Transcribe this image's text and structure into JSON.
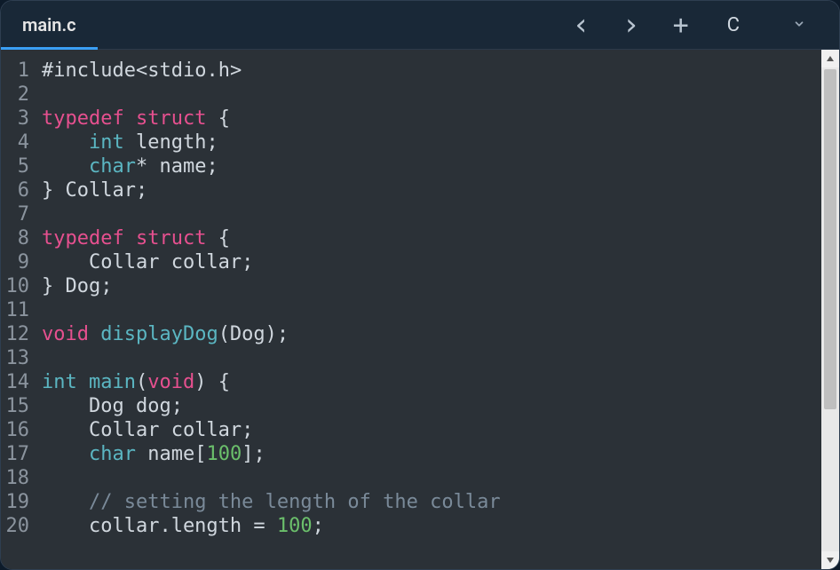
{
  "tab": {
    "filename": "main.c"
  },
  "toolbar": {
    "back_icon": "‹",
    "forward_icon": "›",
    "plus_icon": "+",
    "language_label": "C",
    "chevron_down": "⌄"
  },
  "code": {
    "lines": [
      {
        "n": 1,
        "tokens": [
          {
            "t": "#include",
            "c": "pre"
          },
          {
            "t": "<",
            "c": "lt"
          },
          {
            "t": "stdio.h",
            "c": "ident"
          },
          {
            "t": ">",
            "c": "lt"
          }
        ]
      },
      {
        "n": 2,
        "tokens": []
      },
      {
        "n": 3,
        "tokens": [
          {
            "t": "typedef",
            "c": "kw"
          },
          {
            "t": " ",
            "c": ""
          },
          {
            "t": "struct",
            "c": "kw"
          },
          {
            "t": " {",
            "c": "ident"
          }
        ]
      },
      {
        "n": 4,
        "tokens": [
          {
            "t": "    ",
            "c": ""
          },
          {
            "t": "int",
            "c": "type"
          },
          {
            "t": " length;",
            "c": "ident"
          }
        ]
      },
      {
        "n": 5,
        "tokens": [
          {
            "t": "    ",
            "c": ""
          },
          {
            "t": "char",
            "c": "type"
          },
          {
            "t": "*",
            "c": "star"
          },
          {
            "t": " name;",
            "c": "ident"
          }
        ]
      },
      {
        "n": 6,
        "tokens": [
          {
            "t": "} Collar;",
            "c": "ident"
          }
        ]
      },
      {
        "n": 7,
        "tokens": []
      },
      {
        "n": 8,
        "tokens": [
          {
            "t": "typedef",
            "c": "kw"
          },
          {
            "t": " ",
            "c": ""
          },
          {
            "t": "struct",
            "c": "kw"
          },
          {
            "t": " {",
            "c": "ident"
          }
        ]
      },
      {
        "n": 9,
        "tokens": [
          {
            "t": "    Collar collar;",
            "c": "ident"
          }
        ]
      },
      {
        "n": 10,
        "tokens": [
          {
            "t": "} Dog;",
            "c": "ident"
          }
        ]
      },
      {
        "n": 11,
        "tokens": []
      },
      {
        "n": 12,
        "tokens": [
          {
            "t": "void",
            "c": "kw"
          },
          {
            "t": " ",
            "c": ""
          },
          {
            "t": "displayDog",
            "c": "func"
          },
          {
            "t": "(Dog);",
            "c": "ident"
          }
        ]
      },
      {
        "n": 13,
        "tokens": []
      },
      {
        "n": 14,
        "tokens": [
          {
            "t": "int",
            "c": "type"
          },
          {
            "t": " ",
            "c": ""
          },
          {
            "t": "main",
            "c": "func"
          },
          {
            "t": "(",
            "c": "ident"
          },
          {
            "t": "void",
            "c": "kw"
          },
          {
            "t": ") {",
            "c": "ident"
          }
        ]
      },
      {
        "n": 15,
        "tokens": [
          {
            "t": "    Dog dog;",
            "c": "ident"
          }
        ]
      },
      {
        "n": 16,
        "tokens": [
          {
            "t": "    Collar collar;",
            "c": "ident"
          }
        ]
      },
      {
        "n": 17,
        "tokens": [
          {
            "t": "    ",
            "c": ""
          },
          {
            "t": "char",
            "c": "type"
          },
          {
            "t": " name[",
            "c": "ident"
          },
          {
            "t": "100",
            "c": "num"
          },
          {
            "t": "];",
            "c": "ident"
          }
        ]
      },
      {
        "n": 18,
        "tokens": []
      },
      {
        "n": 19,
        "tokens": [
          {
            "t": "    ",
            "c": ""
          },
          {
            "t": "// setting the length of the collar",
            "c": "cmt"
          }
        ]
      },
      {
        "n": 20,
        "tokens": [
          {
            "t": "    collar.length = ",
            "c": "ident"
          },
          {
            "t": "100",
            "c": "num"
          },
          {
            "t": ";",
            "c": "ident"
          }
        ]
      }
    ]
  },
  "scrollbar": {
    "thumb_top_pct": 0,
    "thumb_height_pct": 70
  }
}
